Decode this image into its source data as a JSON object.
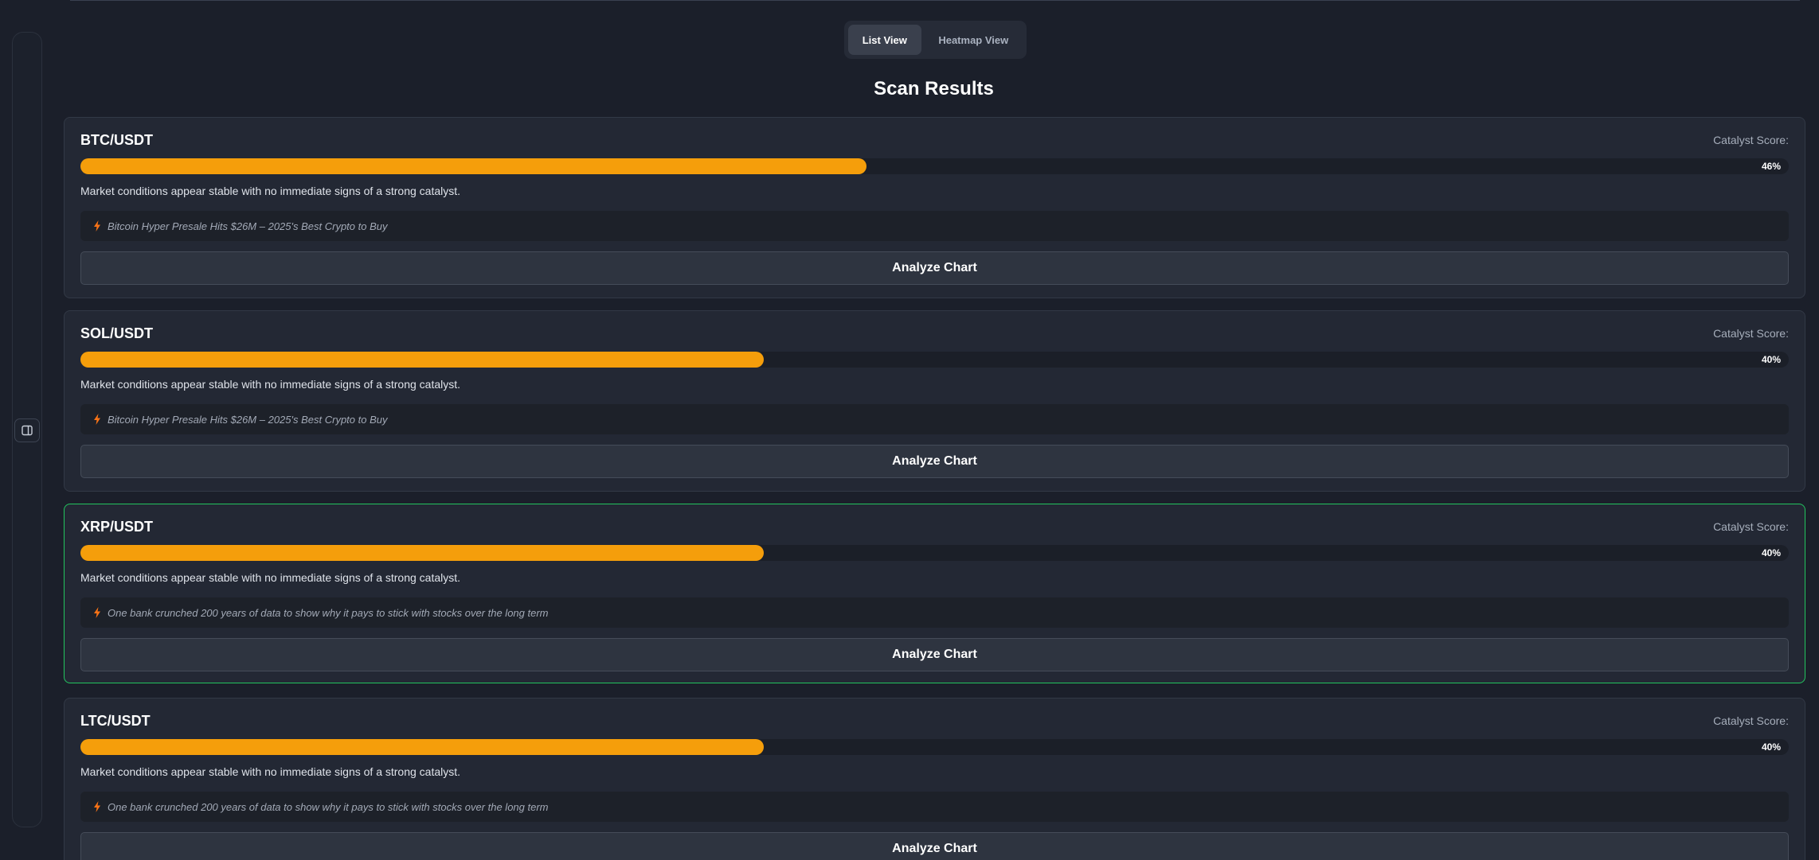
{
  "view_toggle": {
    "list_label": "List View",
    "heatmap_label": "Heatmap View",
    "active": "list"
  },
  "section_title": "Scan Results",
  "colors": {
    "accent_bar": "#f59e0b",
    "highlight_border": "#22c55e",
    "bolt": "#f97316"
  },
  "cards": [
    {
      "pair": "BTC/USDT",
      "score_label": "Catalyst Score:",
      "score_pct": 46,
      "score_text": "46%",
      "description": "Market conditions appear stable with no immediate signs of a strong catalyst.",
      "news_icon": "lightning-bolt-icon",
      "news": "Bitcoin Hyper Presale Hits $26M – 2025's Best Crypto to Buy",
      "button": "Analyze Chart",
      "highlighted": false
    },
    {
      "pair": "SOL/USDT",
      "score_label": "Catalyst Score:",
      "score_pct": 40,
      "score_text": "40%",
      "description": "Market conditions appear stable with no immediate signs of a strong catalyst.",
      "news_icon": "lightning-bolt-icon",
      "news": "Bitcoin Hyper Presale Hits $26M – 2025's Best Crypto to Buy",
      "button": "Analyze Chart",
      "highlighted": false
    },
    {
      "pair": "XRP/USDT",
      "score_label": "Catalyst Score:",
      "score_pct": 40,
      "score_text": "40%",
      "description": "Market conditions appear stable with no immediate signs of a strong catalyst.",
      "news_icon": "lightning-bolt-icon",
      "news": "One bank crunched 200 years of data to show why it pays to stick with stocks over the long term",
      "button": "Analyze Chart",
      "highlighted": true
    },
    {
      "pair": "LTC/USDT",
      "score_label": "Catalyst Score:",
      "score_pct": 40,
      "score_text": "40%",
      "description": "Market conditions appear stable with no immediate signs of a strong catalyst.",
      "news_icon": "lightning-bolt-icon",
      "news": "One bank crunched 200 years of data to show why it pays to stick with stocks over the long term",
      "button": "Analyze Chart",
      "highlighted": false
    }
  ]
}
